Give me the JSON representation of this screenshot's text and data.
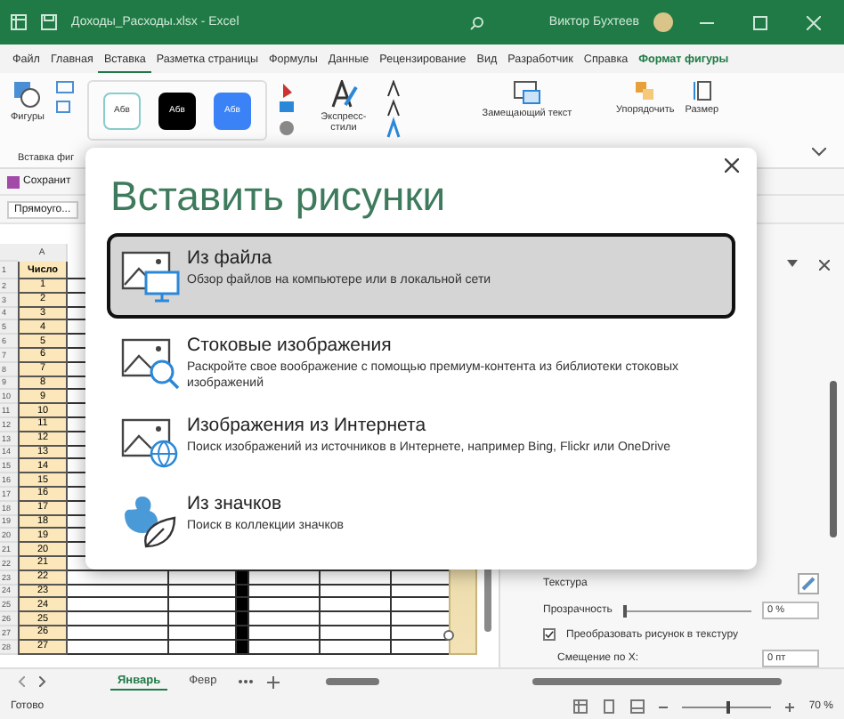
{
  "title_bar": {
    "title": "Доходы_Расходы.xlsx  -  Excel",
    "user": "Виктор Бухтеев"
  },
  "ribbon_tabs": [
    {
      "label": "Файл",
      "selected": false,
      "kind": "normal"
    },
    {
      "label": "Главная",
      "selected": false,
      "kind": "normal"
    },
    {
      "label": "Вставка",
      "selected": true,
      "kind": "normal"
    },
    {
      "label": "Разметка страницы",
      "selected": false,
      "kind": "normal"
    },
    {
      "label": "Формулы",
      "selected": false,
      "kind": "normal"
    },
    {
      "label": "Данные",
      "selected": false,
      "kind": "normal"
    },
    {
      "label": "Рецензирование",
      "selected": false,
      "kind": "normal"
    },
    {
      "label": "Вид",
      "selected": false,
      "kind": "normal"
    },
    {
      "label": "Разработчик",
      "selected": false,
      "kind": "normal"
    },
    {
      "label": "Справка",
      "selected": false,
      "kind": "normal"
    },
    {
      "label": "Формат фигуры",
      "selected": false,
      "kind": "contextual"
    }
  ],
  "ribbon": {
    "shapes": "Фигуры",
    "group_label": "Вставка фиг",
    "style_samples": [
      {
        "label": "Абв",
        "color": "#ffffff"
      },
      {
        "label": "Абв",
        "color": "#000000"
      },
      {
        "label": "Абв",
        "color": "#3b82f6"
      }
    ],
    "express_styles": "Экспресс-стили",
    "alt_text": "Замещающий текст",
    "arrange": "Упорядочить",
    "size": "Размер"
  },
  "save_button": "Сохранит",
  "name_box": "Прямоуго...",
  "sheet": {
    "column_header": "A",
    "rows": [
      {
        "number": "1",
        "a": "Число"
      },
      {
        "number": "2",
        "a": "1"
      },
      {
        "number": "3",
        "a": "2"
      },
      {
        "number": "4",
        "a": "3"
      },
      {
        "number": "5",
        "a": "4"
      },
      {
        "number": "6",
        "a": "5"
      },
      {
        "number": "7",
        "a": "6"
      },
      {
        "number": "8",
        "a": "7"
      },
      {
        "number": "9",
        "a": "8"
      },
      {
        "number": "10",
        "a": "9"
      },
      {
        "number": "11",
        "a": "10"
      },
      {
        "number": "12",
        "a": "11"
      },
      {
        "number": "13",
        "a": "12"
      },
      {
        "number": "14",
        "a": "13"
      },
      {
        "number": "15",
        "a": "14"
      },
      {
        "number": "16",
        "a": "15"
      },
      {
        "number": "17",
        "a": "16"
      },
      {
        "number": "18",
        "a": "17"
      },
      {
        "number": "19",
        "a": "18"
      },
      {
        "number": "20",
        "a": "19"
      },
      {
        "number": "21",
        "a": "20"
      },
      {
        "number": "22",
        "a": "21"
      },
      {
        "number": "23",
        "a": "22"
      },
      {
        "number": "24",
        "a": "23"
      },
      {
        "number": "25",
        "a": "24"
      },
      {
        "number": "26",
        "a": "25"
      },
      {
        "number": "27",
        "a": "26"
      },
      {
        "number": "28",
        "a": "27"
      }
    ]
  },
  "sheet_tabs": [
    {
      "label": "Январь",
      "selected": true
    },
    {
      "label": "Февр",
      "selected": false
    }
  ],
  "format_pane": {
    "texture_label": "Текстура",
    "transparency_label": "Прозрачность",
    "transparency": {
      "level": 0
    },
    "transparency_value": "0 %",
    "tile_checkbox": {
      "label": "Преобразовать рисунок в текстуру",
      "checked": true
    },
    "offset_label": "Смещение по X:",
    "offset_value": "0 пт"
  },
  "status_bar": {
    "status": "Готово",
    "zoom": "70 %",
    "zoom_slider": {
      "level": 0.5
    }
  },
  "dialog": {
    "title": "Вставить рисунки",
    "options": [
      {
        "kind": "file",
        "title": "Из файла",
        "description": "Обзор файлов на компьютере или в локальной сети",
        "selected": true
      },
      {
        "kind": "stock",
        "title": "Стоковые изображения",
        "description": "Раскройте свое воображение с помощью премиум-контента из библиотеки стоковых изображений",
        "selected": false
      },
      {
        "kind": "online",
        "title": "Изображения из Интернета",
        "description": "Поиск изображений из источников в Интернете, например Bing, Flickr или OneDrive",
        "selected": false
      },
      {
        "kind": "icons",
        "title": "Из значков",
        "description": "Поиск в коллекции значков",
        "selected": false
      }
    ]
  }
}
